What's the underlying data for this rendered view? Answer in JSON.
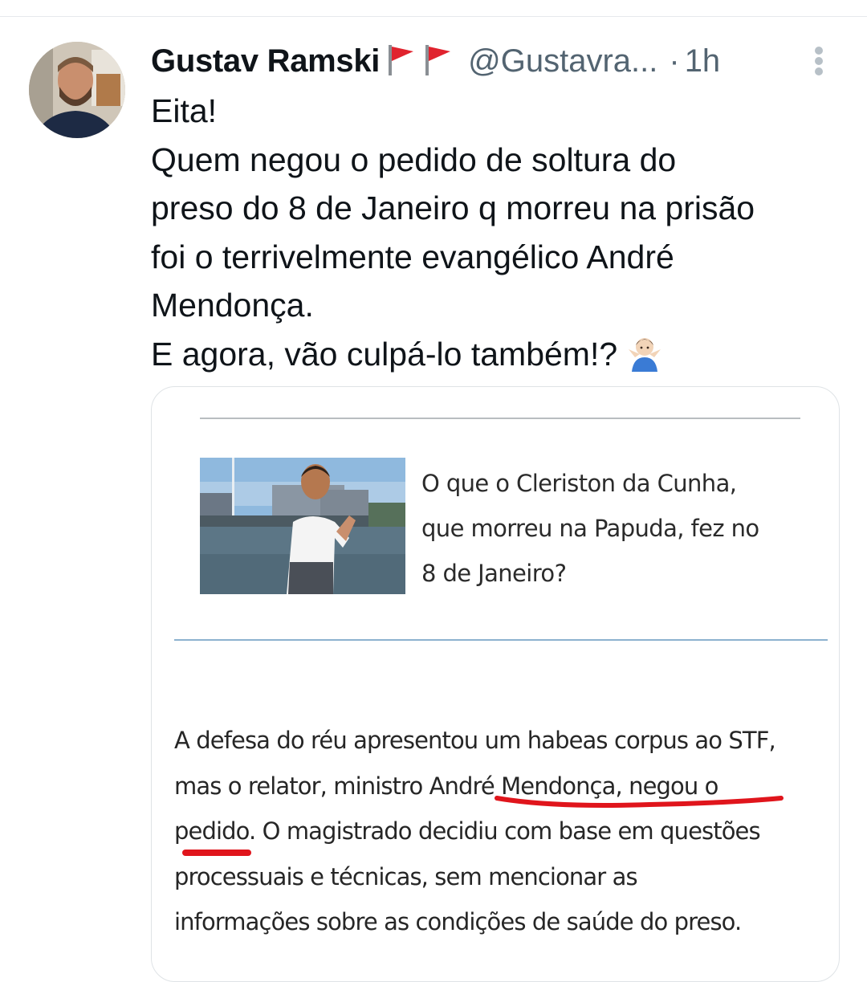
{
  "tweet": {
    "author": {
      "display_name": "Gustav Ramski",
      "handle": "@Gustavra...",
      "separator": "·",
      "time": "1h",
      "flags": [
        "red-flag-icon",
        "red-flag-icon"
      ]
    },
    "text_lines": [
      "Eita!",
      "Quem negou o pedido de soltura do",
      "preso do 8 de Janeiro  q morreu na prisão",
      "foi o terrivelmente evangélico André",
      "Mendonça.",
      "E agora, vão culpá-lo também!?"
    ],
    "trailing_emoji": "person-shrugging-icon",
    "card": {
      "headline_lines": [
        "O que o Cleriston da Cunha,",
        "que morreu na Papuda, fez no",
        "8 de Janeiro?"
      ],
      "body_lines": [
        "A defesa do réu apresentou um habeas corpus ao STF,",
        "mas o relator, ministro André Mendonça, negou o",
        "pedido. O magistrado decidiu com base em questões",
        "processuais e técnicas, sem mencionar as",
        "informações sobre as condições de saúde do preso."
      ]
    }
  },
  "colors": {
    "text": "#0f1419",
    "secondary": "#536471",
    "flag_red": "#e0232e",
    "highlight_underline": "#e0151c"
  }
}
